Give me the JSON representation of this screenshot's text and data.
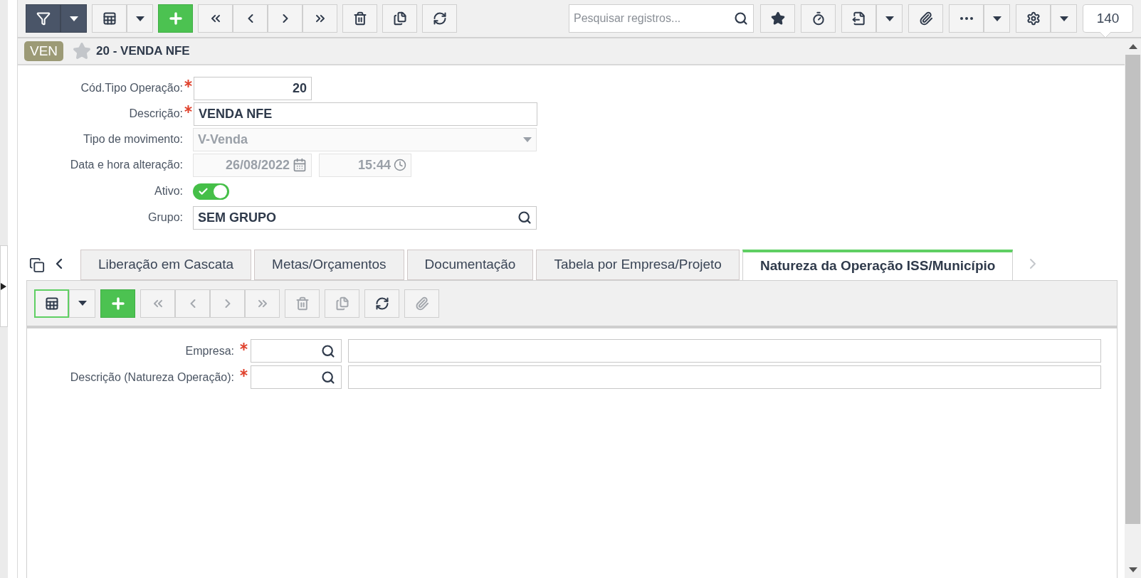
{
  "toolbar": {
    "left_groups": [
      {
        "buttons": [
          {
            "kind": "filter",
            "active": true
          },
          {
            "kind": "caret",
            "active": true
          }
        ]
      },
      {
        "buttons": [
          {
            "kind": "grid",
            "active": false
          },
          {
            "kind": "caret",
            "active": false
          }
        ]
      },
      {
        "buttons": [
          {
            "kind": "add"
          }
        ]
      },
      {
        "buttons": [
          {
            "kind": "first"
          },
          {
            "kind": "prev"
          },
          {
            "kind": "next"
          },
          {
            "kind": "last"
          }
        ]
      },
      {
        "buttons": [
          {
            "kind": "delete"
          }
        ]
      },
      {
        "buttons": [
          {
            "kind": "duplicate"
          }
        ]
      },
      {
        "buttons": [
          {
            "kind": "refresh"
          }
        ]
      }
    ],
    "search": {
      "placeholder": "Pesquisar registros..."
    },
    "right_groups": [
      {
        "buttons": [
          {
            "kind": "favorite"
          }
        ]
      },
      {
        "buttons": [
          {
            "kind": "timer"
          }
        ]
      },
      {
        "buttons": [
          {
            "kind": "export"
          },
          {
            "kind": "caret"
          }
        ]
      },
      {
        "buttons": [
          {
            "kind": "attach"
          }
        ]
      },
      {
        "buttons": [
          {
            "kind": "more"
          },
          {
            "kind": "caret"
          }
        ]
      },
      {
        "buttons": [
          {
            "kind": "settings"
          },
          {
            "kind": "caret"
          }
        ]
      }
    ],
    "count": "140"
  },
  "header": {
    "badge": "VEN",
    "title": "20 - VENDA NFE",
    "favorite": false
  },
  "form": {
    "fields": [
      {
        "kind": "number",
        "label": "Cód.Tipo Operação:",
        "required": true,
        "value": "20"
      },
      {
        "kind": "text",
        "label": "Descrição:",
        "required": true,
        "value": "VENDA NFE"
      },
      {
        "kind": "select",
        "label": "Tipo de movimento:",
        "disabled": true,
        "value": "V-Venda"
      },
      {
        "kind": "datetime",
        "label": "Data e hora alteração:",
        "disabled": true,
        "date": "26/08/2022",
        "time": "15:44"
      },
      {
        "kind": "toggle",
        "label": "Ativo:",
        "on": true
      },
      {
        "kind": "lookup",
        "label": "Grupo:",
        "value": "SEM GRUPO"
      }
    ]
  },
  "tabs": [
    {
      "label": "Liberação em Cascata",
      "selected": false
    },
    {
      "label": "Metas/Orçamentos",
      "selected": false
    },
    {
      "label": "Documentação",
      "selected": false
    },
    {
      "label": "Tabela por Empresa/Projeto",
      "selected": false
    },
    {
      "label": "Natureza da Operação ISS/Município",
      "selected": true
    }
  ],
  "subform": {
    "toolbar": [
      {
        "buttons": [
          {
            "kind": "grid",
            "selected": true
          },
          {
            "kind": "caret",
            "selected": false
          }
        ]
      },
      {
        "buttons": [
          {
            "kind": "add"
          }
        ]
      },
      {
        "buttons": [
          {
            "kind": "first",
            "disabled": true
          },
          {
            "kind": "prev",
            "disabled": true
          },
          {
            "kind": "next",
            "disabled": true
          },
          {
            "kind": "last",
            "disabled": true
          }
        ]
      },
      {
        "buttons": [
          {
            "kind": "delete",
            "disabled": true
          }
        ]
      },
      {
        "buttons": [
          {
            "kind": "duplicate",
            "disabled": true
          }
        ]
      },
      {
        "buttons": [
          {
            "kind": "refresh",
            "disabled": false
          }
        ]
      },
      {
        "buttons": [
          {
            "kind": "attach",
            "disabled": true
          }
        ]
      }
    ],
    "fields": [
      {
        "label": "Empresa:",
        "required": true
      },
      {
        "label": "Descrição (Natureza Operação):",
        "required": true
      }
    ]
  }
}
